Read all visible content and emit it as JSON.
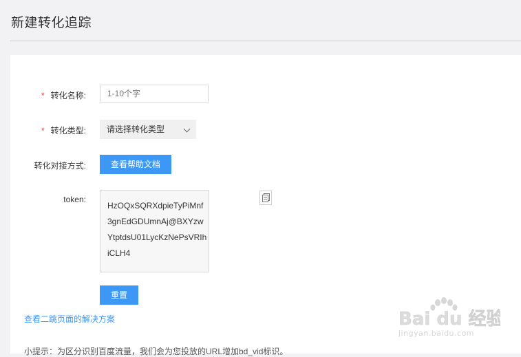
{
  "page": {
    "title": "新建转化追踪"
  },
  "form": {
    "required_mark": "*",
    "name_label": "转化名称:",
    "name_placeholder": "1-10个字",
    "type_label": "转化类型:",
    "type_value": "请选择转化类型",
    "method_label": "转化对接方式:",
    "help_button": "查看帮助文档",
    "token_label": "token:",
    "token_lines": [
      "HzOQxSQRXdpieTyPiMnf",
      "3gnEdGDUmnAj@BXYzw",
      "YtptdsU01LycKzNePsVRIh",
      "iCLH4"
    ],
    "reset_button": "重置",
    "secondary_link": "查看二跳页面的解决方案",
    "tip": "小提示：为区分识别百度流量，我们会为您投放的URL增加bd_vid标识。"
  },
  "watermark": {
    "brand": "Bai du 经验",
    "url": "jingyan.baidu.com"
  },
  "colors": {
    "primary": "#3d98f5",
    "required": "#e83535",
    "background": "#f2f2f4"
  },
  "icons": {
    "copy": "copy-icon",
    "dropdown": "chevron-down-icon"
  }
}
